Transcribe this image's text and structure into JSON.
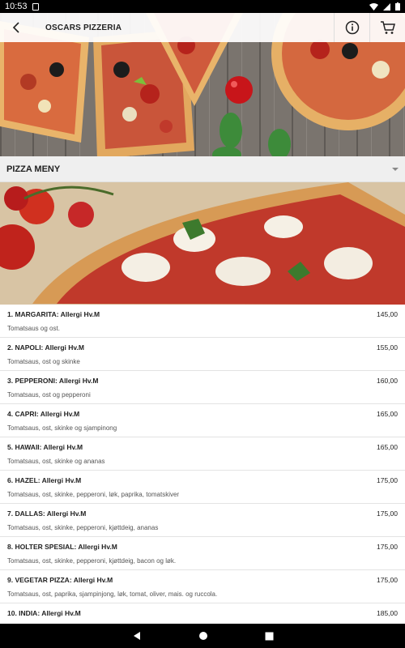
{
  "status_bar": {
    "time": "10:53"
  },
  "header": {
    "title": "OSCARS PIZZERIA"
  },
  "section": {
    "label": "PIZZA MENY"
  },
  "menu_items": [
    {
      "name": "1. MARGARITA: Allergi Hv.M",
      "description": "Tomatsaus og ost.",
      "price": "145,00"
    },
    {
      "name": "2. NAPOLI: Allergi Hv.M",
      "description": "Tomatsaus, ost og skinke",
      "price": "155,00"
    },
    {
      "name": "3. PEPPERONI: Allergi Hv.M",
      "description": "Tomatsaus, ost og pepperoni",
      "price": "160,00"
    },
    {
      "name": "4. CAPRI: Allergi Hv.M",
      "description": "Tomatsaus, ost, skinke og sjampinong",
      "price": "165,00"
    },
    {
      "name": "5. HAWAII: Allergi Hv.M",
      "description": "Tomatsaus, ost, skinke og ananas",
      "price": "165,00"
    },
    {
      "name": "6. HAZEL: Allergi Hv.M",
      "description": "Tomatsaus, ost, skinke, pepperoni, løk, paprika, tomatskiver",
      "price": "175,00"
    },
    {
      "name": "7. DALLAS: Allergi Hv.M",
      "description": "Tomatsaus, ost, skinke, pepperoni, kjøttdeig, ananas",
      "price": "175,00"
    },
    {
      "name": "8. HOLTER SPESIAL: Allergi Hv.M",
      "description": "Tomatsaus, ost, skinke, pepperoni, kjøttdeig, bacon og løk.",
      "price": "175,00"
    },
    {
      "name": "9. VEGETAR PIZZA: Allergi Hv.M",
      "description": "Tomatsaus, ost, paprika, sjampinjong, løk, tomat, oliver, mais. og ruccola.",
      "price": "175,00"
    },
    {
      "name": "10. INDIA: Allergi Hv.M",
      "description": "",
      "price": "185,00"
    }
  ]
}
